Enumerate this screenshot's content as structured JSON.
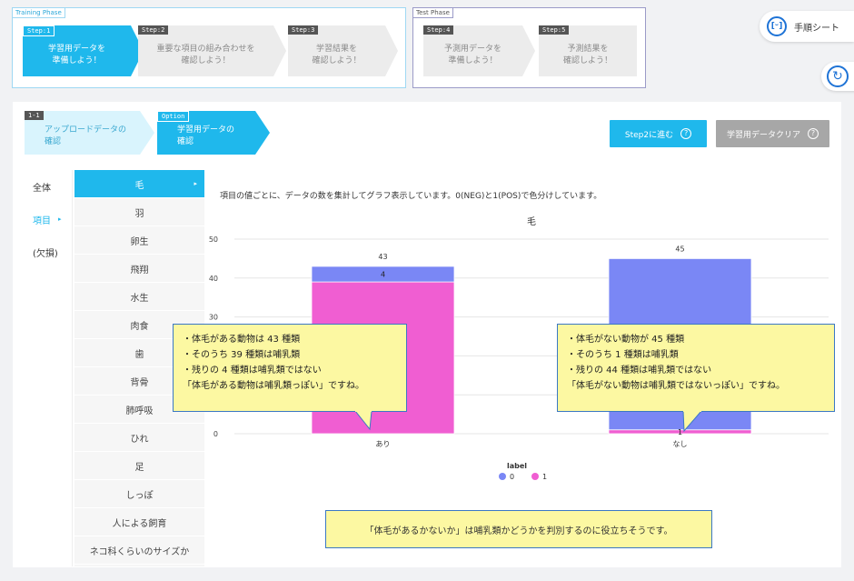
{
  "phases": {
    "training_title": "Training Phase",
    "test_title": "Test Phase",
    "steps": [
      {
        "tag": "Step:1",
        "label": "学習用データを\n準備しよう！"
      },
      {
        "tag": "Step:2",
        "label": "重要な項目の組み合わせを\n確認しよう！"
      },
      {
        "tag": "Step:3",
        "label": "学習結果を\n確認しよう！"
      },
      {
        "tag": "Step:4",
        "label": "予測用データを\n準備しよう！"
      },
      {
        "tag": "Step:5",
        "label": "予測結果を\n確認しよう！"
      }
    ]
  },
  "manual_button": {
    "label": "手順シート",
    "icon": "manual-icon"
  },
  "refresh_icon": "refresh-icon",
  "substeps": [
    {
      "tag": "1-1",
      "label": "アップロードデータの\n確認"
    },
    {
      "tag": "Option",
      "label": "学習用データの\n確認"
    }
  ],
  "buttons": {
    "next": "Step2に進む",
    "clear": "学習用データクリア",
    "help_glyph": "?"
  },
  "colors": {
    "accent": "#1fb8ec",
    "series0": "#7a87f5",
    "series1": "#f05ed2",
    "callout_bg": "#fcf8a2"
  },
  "categories_nav": [
    "全体",
    "項目",
    "(欠損)"
  ],
  "features": [
    "毛",
    "羽",
    "卵生",
    "飛翔",
    "水生",
    "肉食",
    "歯",
    "背骨",
    "肺呼吸",
    "ひれ",
    "足",
    "しっぽ",
    "人による飼育",
    "ネコ科くらいのサイズか"
  ],
  "description": "項目の値ごとに、データの数を集計してグラフ表示しています。0(NEG)と1(POS)で色分けしています。",
  "chart_data": {
    "type": "bar",
    "stacked": true,
    "title": "毛",
    "categories": [
      "あり",
      "なし"
    ],
    "series": [
      {
        "name": "0",
        "values": [
          4,
          44
        ]
      },
      {
        "name": "1",
        "values": [
          39,
          1
        ]
      }
    ],
    "totals": [
      "43",
      "45"
    ],
    "segment_labels": [
      "4",
      "1"
    ],
    "ylim": [
      0,
      50
    ],
    "yticks": [
      0,
      10,
      20,
      30,
      40,
      50
    ],
    "legend_title": "label",
    "legend_position": "bottom"
  },
  "callout_left": [
    "・体毛がある動物は 43 種類",
    "・そのうち 39 種類は哺乳類",
    "・残りの 4 種類は哺乳類ではない",
    "「体毛がある動物は哺乳類っぽい」ですね。"
  ],
  "callout_right": [
    "・体毛がない動物が 45 種類",
    "・そのうち 1 種類は哺乳類",
    "・残りの 44 種類は哺乳類ではない",
    "「体毛がない動物は哺乳類ではないっぽい」ですね。"
  ],
  "note": "「体毛があるかないか」は哺乳類かどうかを判別するのに役立ちそうです。"
}
